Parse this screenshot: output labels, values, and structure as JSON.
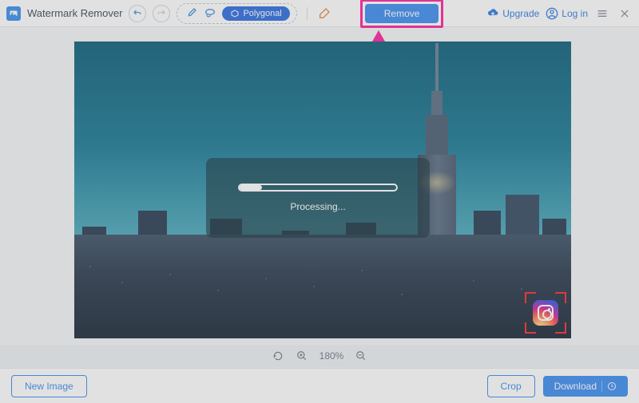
{
  "app": {
    "title": "Watermark Remover"
  },
  "toolbar": {
    "polygonal_label": "Polygonal",
    "remove_label": "Remove",
    "upgrade_label": "Upgrade",
    "login_label": "Log in"
  },
  "processing": {
    "label": "Processing..."
  },
  "zoom": {
    "level": "180%"
  },
  "footer": {
    "new_image_label": "New Image",
    "crop_label": "Crop",
    "download_label": "Download"
  },
  "annotation": {
    "highlight_target": "remove-button",
    "arrow_color": "#ff1f9e"
  },
  "watermark": {
    "icon": "instagram"
  }
}
